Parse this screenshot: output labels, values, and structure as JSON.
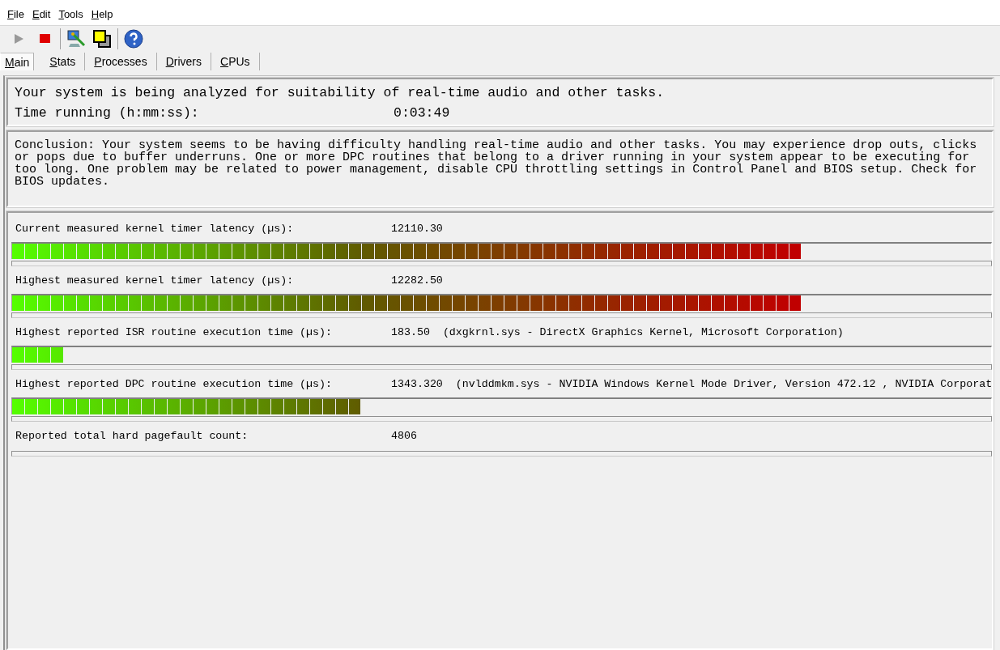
{
  "menu": [
    "File",
    "Edit",
    "Tools",
    "Help"
  ],
  "toolbar": [
    {
      "kind": "play"
    },
    {
      "kind": "stop"
    },
    {
      "kind": "sep"
    },
    {
      "kind": "monitor"
    },
    {
      "kind": "windows"
    },
    {
      "kind": "sep"
    },
    {
      "kind": "help"
    }
  ],
  "tabs": [
    {
      "label": "Main",
      "selected": true
    },
    {
      "label": "Stats",
      "selected": false
    },
    {
      "label": "Processes",
      "selected": false
    },
    {
      "label": "Drivers",
      "selected": false
    },
    {
      "label": "CPUs",
      "selected": false
    }
  ],
  "status": {
    "message": "Your system is being analyzed for suitability of real-time audio and other tasks.",
    "time_label": "Time running (h:mm:ss):",
    "time_value": "0:03:49"
  },
  "conclusion": "Conclusion: Your system seems to be having difficulty handling real-time audio and other tasks. You may experience drop outs, clicks or pops due to buffer underruns. One or more DPC routines that belong to a driver running in your system appear to be executing for too long. One problem may be related to power management, disable CPU throttling settings in Control Panel and BIOS setup. Check for BIOS updates.",
  "metrics": [
    {
      "label": "Current measured kernel timer latency (µs):",
      "value": "12110.30",
      "level": 0.806
    },
    {
      "label": "Highest measured kernel timer latency (µs):",
      "value": "12282.50",
      "level": 0.806
    },
    {
      "label": "Highest reported ISR routine execution time (µs):",
      "value": "183.50",
      "detail": "(dxgkrnl.sys - DirectX Graphics Kernel, Microsoft Corporation)",
      "level": 0.052
    },
    {
      "label": "Highest reported DPC routine execution time (µs):",
      "value": "1343.320",
      "detail": "(nvlddmkm.sys - NVIDIA Windows Kernel Mode Driver, Version 472.12 , NVIDIA Corporat",
      "level": 0.356
    },
    {
      "label": "Reported total hard pagefault count:",
      "value": "4806"
    }
  ]
}
